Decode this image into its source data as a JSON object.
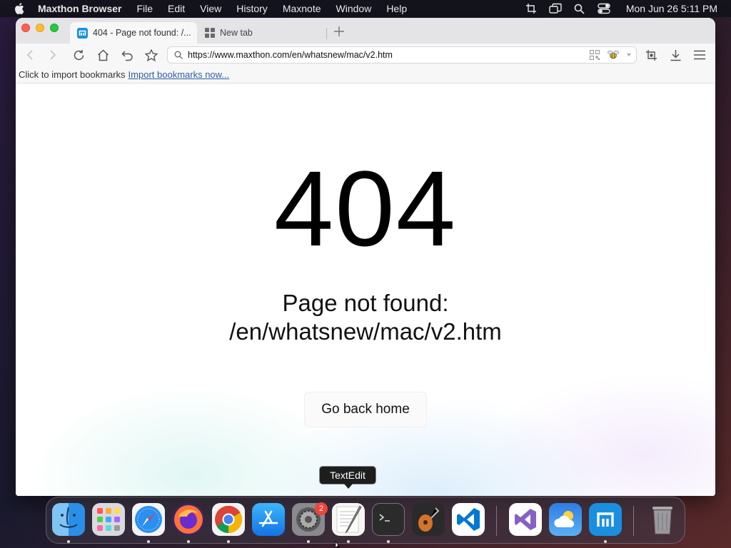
{
  "menubar": {
    "app_name": "Maxthon Browser",
    "items": [
      "File",
      "Edit",
      "View",
      "History",
      "Maxnote",
      "Window",
      "Help"
    ],
    "clock": "Mon Jun 26  5:11 PM"
  },
  "tabs": {
    "active_title": "404 - Page not found: /...",
    "inactive_title": "New tab"
  },
  "toolbar": {
    "url": "https://www.maxthon.com/en/whatsnew/mac/v2.htm"
  },
  "bookmarks": {
    "prompt": "Click to import bookmarks",
    "link": "Import bookmarks now..."
  },
  "page": {
    "code": "404",
    "message_line1": "Page not found:",
    "message_line2": "/en/whatsnew/mac/v2.htm",
    "button": "Go back home"
  },
  "tooltip": {
    "label": "TextEdit"
  },
  "dock": {
    "apps": [
      "Finder",
      "Launchpad",
      "Safari",
      "Firefox",
      "Chrome",
      "App Store",
      "System Preferences",
      "TextEdit",
      "Terminal",
      "GarageBand",
      "Visual Studio Code",
      "Visual Studio",
      "Weather",
      "Maxthon",
      "Trash"
    ],
    "settings_badge": "2"
  },
  "colors": {
    "close": "#fe5f57",
    "minimize": "#febc2e",
    "maximize": "#28c840",
    "link": "#2c5fa8",
    "maxthon_blue": "#1a8fe0"
  }
}
